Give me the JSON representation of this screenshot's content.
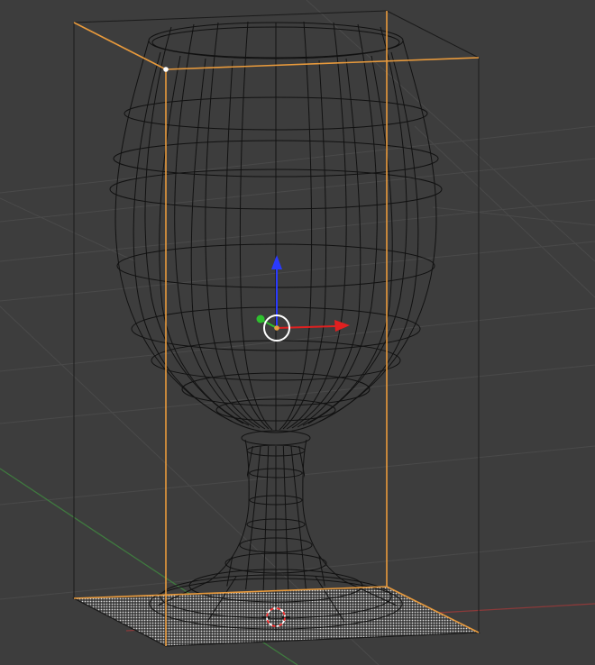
{
  "viewport": {
    "background": "#3d3d3d",
    "grid_color": "#4a4a4a",
    "x_axis_color": "#8b3a3a",
    "y_axis_color": "#3f7a3f"
  },
  "object": {
    "wire_color": "#111111",
    "selection_color": "#e89a3c",
    "bounding_box_color": "#1a1a1a",
    "selected_vertex_color": "#ffffff"
  },
  "gizmo": {
    "x_arrow_color": "#e02020",
    "y_handle_color": "#2ec02e",
    "z_arrow_color": "#2a3aff",
    "pivot_ring_color": "#ffffff",
    "origin_color": "#e8a040"
  },
  "cursor_3d": {
    "colors": [
      "#ff3030",
      "#ffffff"
    ],
    "icon": "3d-cursor-icon"
  }
}
